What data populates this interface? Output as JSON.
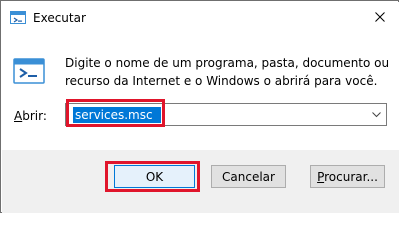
{
  "window": {
    "title": "Executar",
    "close_icon": "close-icon"
  },
  "description": {
    "line1": "Digite o nome de um programa, pasta, documento ou",
    "line2": "recurso da Internet e o Windows o abrirá para você."
  },
  "open": {
    "label_mnemonic": "A",
    "label_rest": "brir:",
    "value": "services.msc"
  },
  "buttons": {
    "ok": "OK",
    "cancel": "Cancelar",
    "browse_mnemonic": "P",
    "browse_rest": "rocurar..."
  },
  "colors": {
    "highlight": "#e0152b",
    "selection": "#0078d7",
    "footer_bg": "#f0f0f0"
  }
}
